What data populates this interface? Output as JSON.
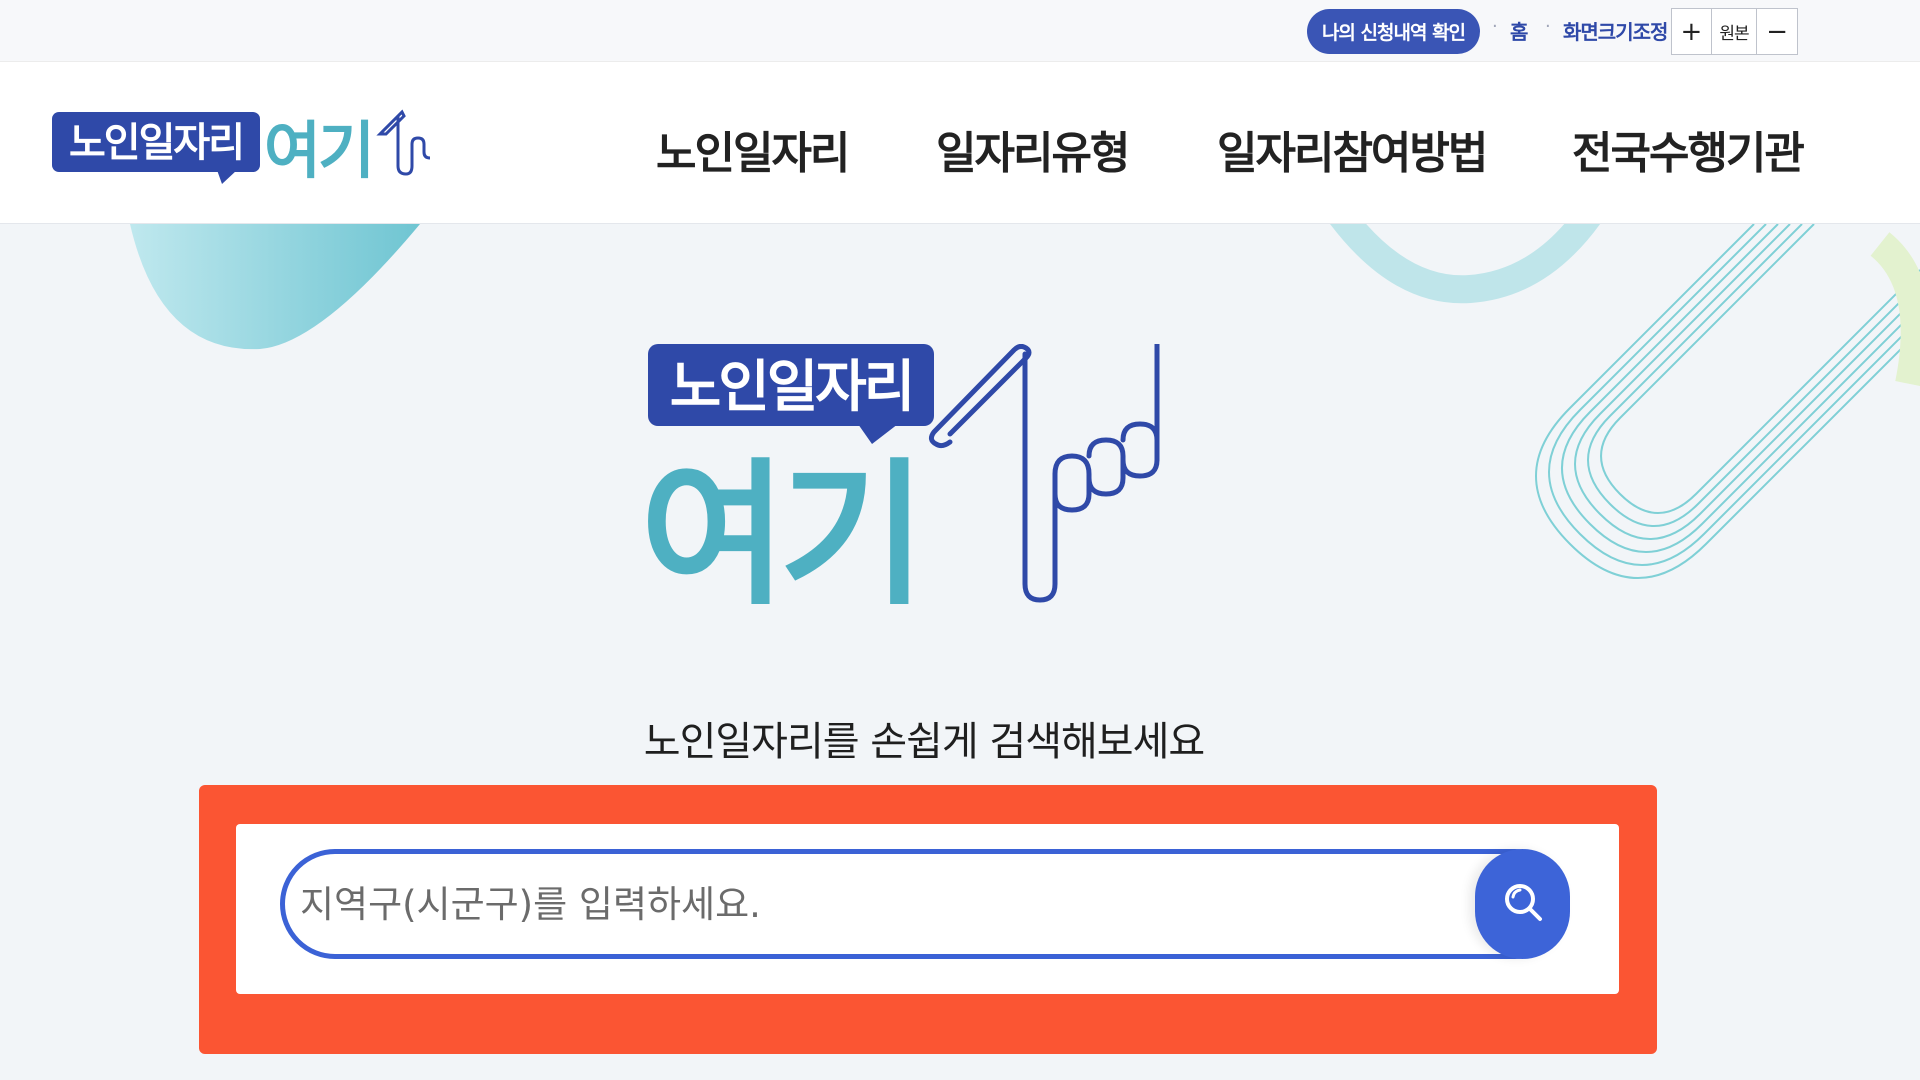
{
  "utility": {
    "my_application": "나의 신청내역 확인",
    "home": "홈",
    "screen_size": "화면크기조정",
    "zoom_in": "+",
    "zoom_original": "원본",
    "zoom_out": "−"
  },
  "header": {
    "logo_top": "노인일자리",
    "logo_bottom": "여기",
    "nav": [
      "노인일자리",
      "일자리유형",
      "일자리참여방법",
      "전국수행기관"
    ]
  },
  "hero": {
    "logo_top": "노인일자리",
    "logo_bottom": "여기",
    "tagline": "노인일자리를 손쉽게 검색해보세요",
    "search_placeholder": "지역구(시군구)를 입력하세요."
  },
  "colors": {
    "brand_navy": "#2f49a8",
    "brand_teal": "#4eb0c2",
    "search_blue": "#3b62d6",
    "highlight_red": "#fb5533"
  },
  "icons": {
    "search": "search-icon"
  }
}
